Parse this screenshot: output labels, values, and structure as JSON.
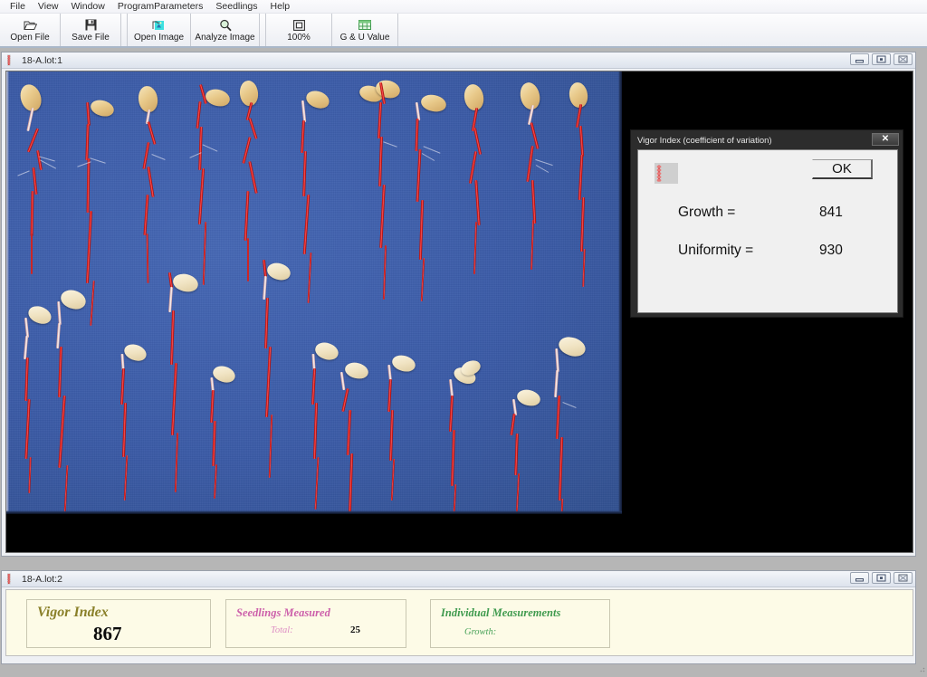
{
  "app": {
    "menu": [
      {
        "label": "File",
        "name": "menu-file"
      },
      {
        "label": "View",
        "name": "menu-view"
      },
      {
        "label": "Window",
        "name": "menu-window"
      },
      {
        "label": "ProgramParameters",
        "name": "menu-programparameters"
      },
      {
        "label": "Seedlings",
        "name": "menu-seedlings"
      },
      {
        "label": "Help",
        "name": "menu-help"
      }
    ],
    "toolbar": [
      {
        "label": "Open File",
        "icon": "open-folder-icon"
      },
      {
        "label": "Save File",
        "icon": "floppy-disk-icon"
      },
      {
        "label": "Open Image",
        "icon": "open-image-icon"
      },
      {
        "label": "Analyze Image",
        "icon": "magnifier-icon"
      },
      {
        "label": "100%",
        "icon": "zoom-actual-size-icon"
      },
      {
        "label": "G & U Value",
        "icon": "grid-table-icon"
      }
    ]
  },
  "window_image": {
    "title": "18-A.lot:1",
    "controls": {
      "minimize": "minimize-icon",
      "maximize": "restore-icon",
      "close": "close-icon"
    }
  },
  "window_results": {
    "title": "18-A.lot:2",
    "controls": {
      "minimize": "minimize-icon",
      "maximize": "restore-icon",
      "close": "close-icon"
    },
    "panels": {
      "vigor": {
        "heading": "Vigor Index",
        "value": "867",
        "color": "#8a8029"
      },
      "seedlings": {
        "heading": "Seedlings Measured",
        "total_label": "Total:",
        "total_value": "25",
        "color": "#cc5faa"
      },
      "individual": {
        "heading": "Individual Measurements",
        "growth_label": "Growth:",
        "color": "#3f9a4e"
      }
    }
  },
  "dialog": {
    "title": "Vigor Index (coefficient of variation)",
    "ok_label": "OK",
    "close_glyph": "✕",
    "rows": [
      {
        "label": "Growth =",
        "value": "841"
      },
      {
        "label": "Uniformity =",
        "value": "930"
      }
    ]
  },
  "colors": {
    "photo_background": "#3a5aa6",
    "canvas_background": "#000000",
    "chrome": "#eef0f4",
    "results_background": "#fdfbe7"
  }
}
